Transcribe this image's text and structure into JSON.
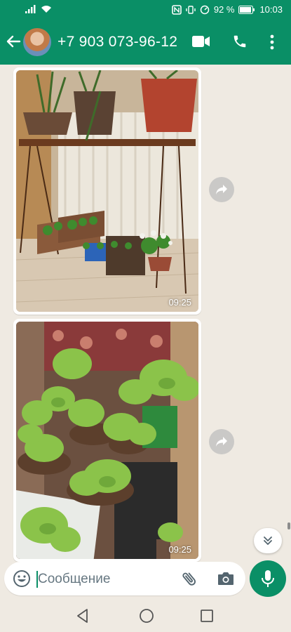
{
  "status_bar": {
    "battery_percent": "92 %",
    "time": "10:03"
  },
  "header": {
    "contact": "+7 903 073-96-12"
  },
  "messages": [
    {
      "time": "09:25"
    },
    {
      "time": "09:25"
    }
  ],
  "input": {
    "placeholder": "Сообщение"
  },
  "colors": {
    "accent": "#0a8f66",
    "chat_bg": "#efeae2"
  },
  "icons": [
    "back-arrow-icon",
    "video-call-icon",
    "phone-icon",
    "more-menu-icon",
    "forward-icon",
    "emoji-icon",
    "attach-icon",
    "camera-icon",
    "mic-icon"
  ]
}
